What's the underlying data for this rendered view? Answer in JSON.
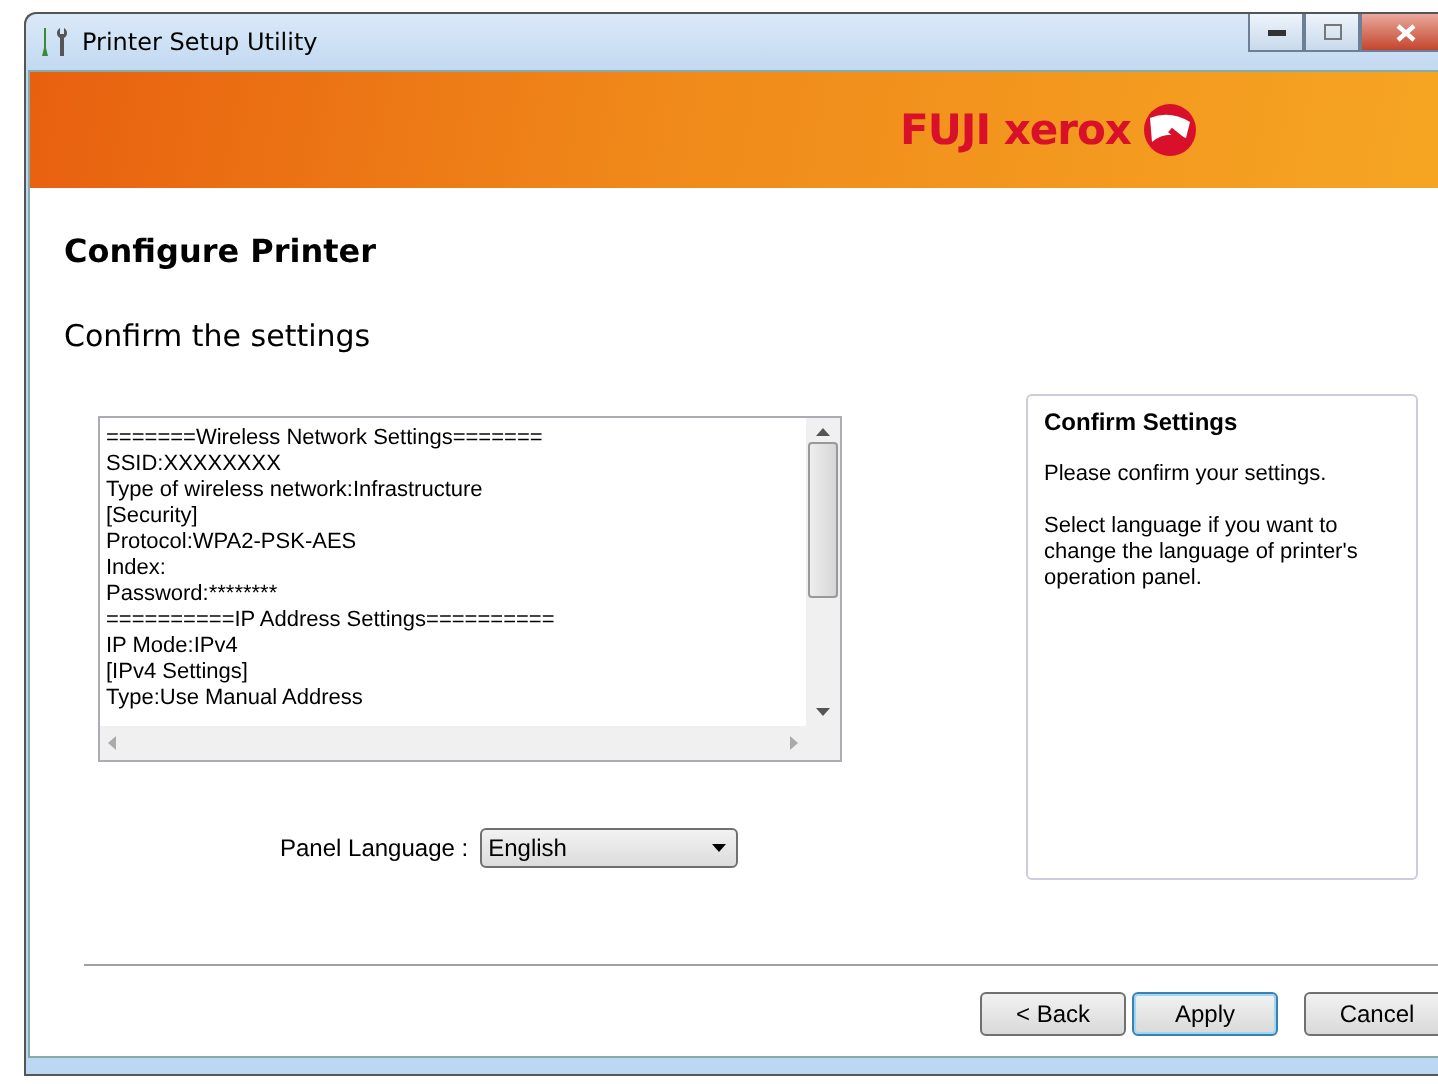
{
  "window": {
    "title": "Printer Setup Utility"
  },
  "banner": {
    "logo": "FUJI xerox"
  },
  "heading": "Configure Printer",
  "subheading": "Confirm the settings",
  "settings_lines": [
    "=======Wireless Network Settings=======",
    "SSID:XXXXXXXX",
    "Type of wireless network:Infrastructure",
    "[Security]",
    "Protocol:WPA2-PSK-AES",
    "Index:",
    "Password:********",
    "==========IP Address Settings==========",
    "IP Mode:IPv4",
    "[IPv4 Settings]",
    "Type:Use Manual Address"
  ],
  "help": {
    "title": "Confirm Settings",
    "paragraphs": [
      "Please confirm your settings.",
      "Select language if you want to change the language of printer's operation panel."
    ]
  },
  "panel_language": {
    "label": "Panel Language :",
    "value": "English"
  },
  "buttons": [
    {
      "label": "< Back",
      "default": false
    },
    {
      "label": "Apply",
      "default": true
    },
    {
      "label": "Cancel",
      "default": false
    }
  ]
}
